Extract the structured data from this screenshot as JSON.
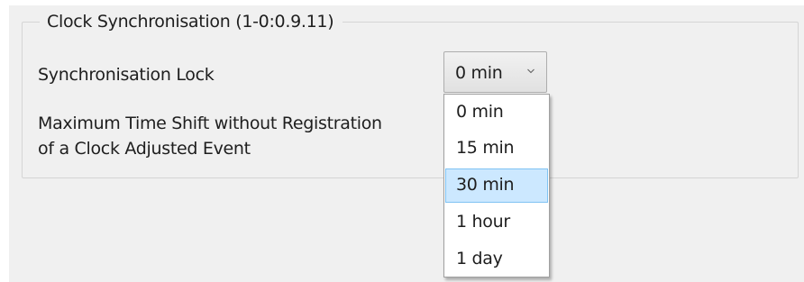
{
  "group": {
    "title": "Clock Synchronisation (1-0:0.9.11)"
  },
  "fields": {
    "sync_lock_label": "Synchronisation Lock",
    "max_shift_label_line1": "Maximum Time Shift without Registration",
    "max_shift_label_line2": "of a Clock Adjusted Event"
  },
  "combo": {
    "value": "0 min",
    "icon": "chevron-down-icon",
    "options": [
      "0 min",
      "15 min",
      "30 min",
      "1 hour",
      "1 day"
    ],
    "highlighted_option": "30 min"
  },
  "colors": {
    "panel_background": "#f0f0f0",
    "highlight_background": "#cce8ff",
    "highlight_border": "#7fc3f3"
  }
}
